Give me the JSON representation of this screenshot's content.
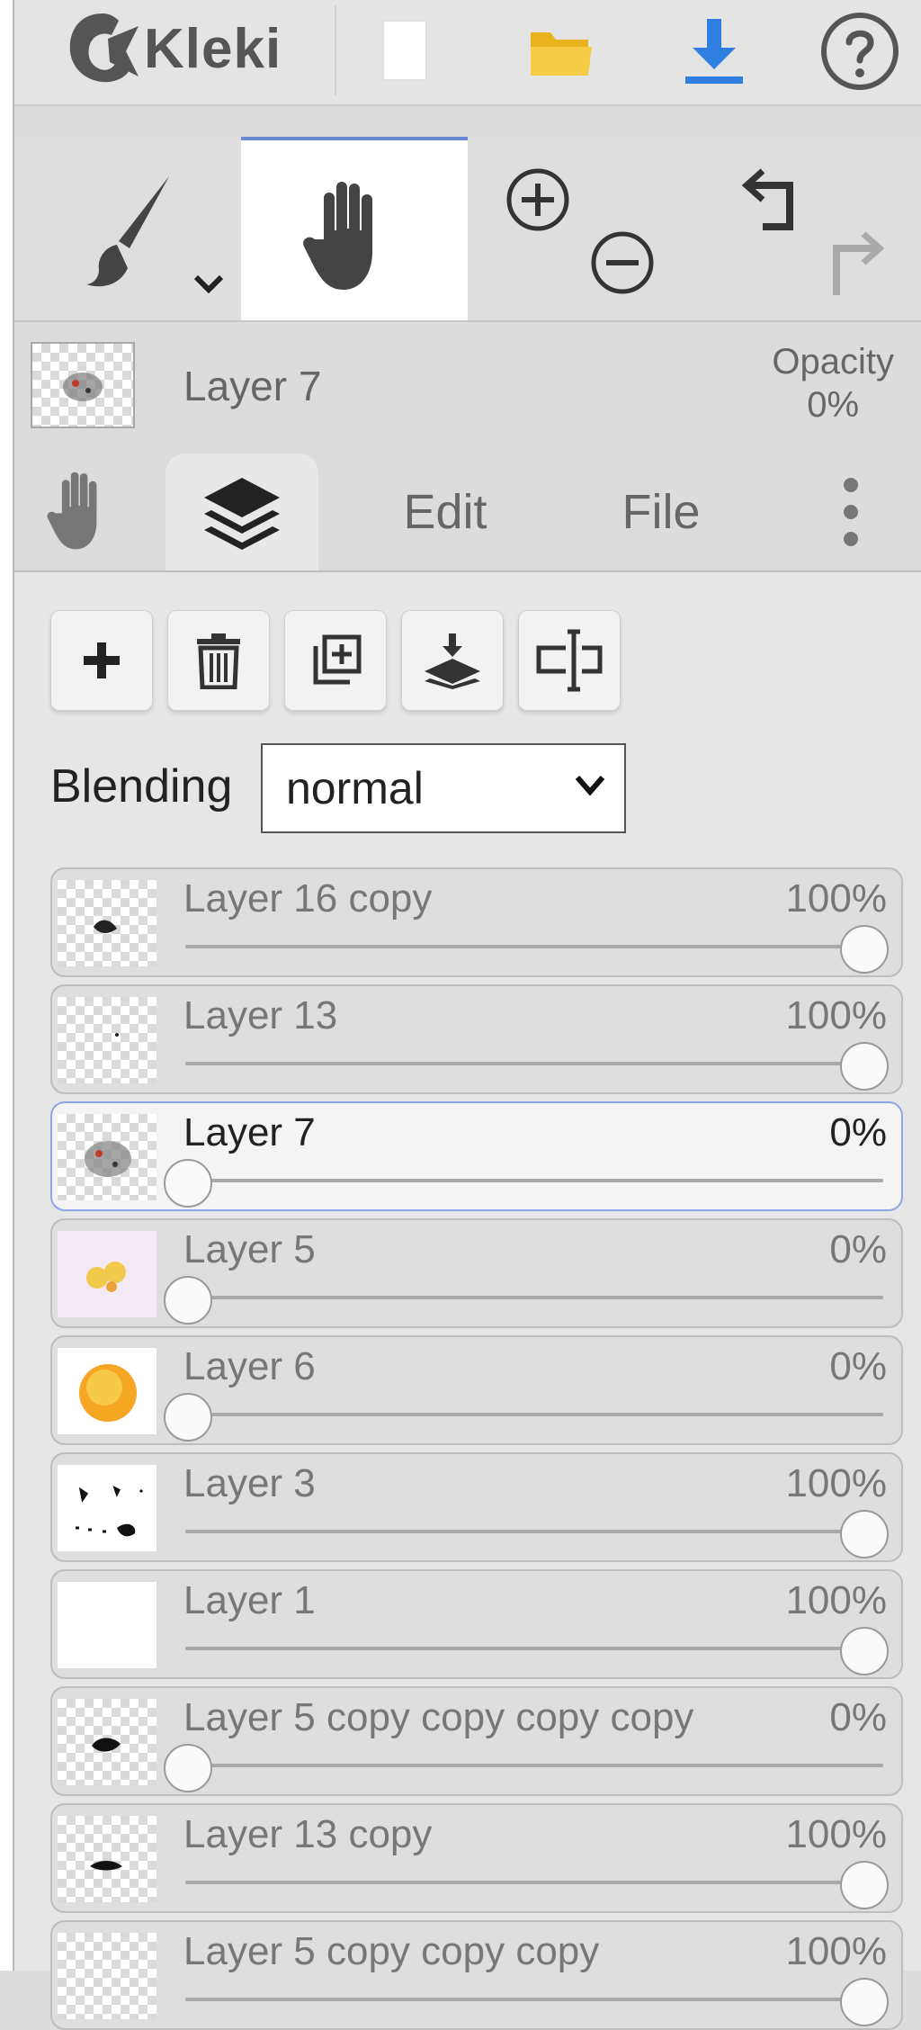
{
  "app": {
    "name": "Kleki"
  },
  "topbar": {
    "buttons": [
      "new-image",
      "open-file",
      "download",
      "help"
    ]
  },
  "toolbar": {
    "tools": [
      "brush",
      "hand",
      "zoom-in",
      "zoom-out",
      "undo",
      "redo"
    ],
    "active_tool": "hand"
  },
  "current_layer": {
    "name": "Layer 7",
    "opacity_label": "Opacity",
    "opacity_value": "0%"
  },
  "tabs": {
    "edit": "Edit",
    "file": "File",
    "active": "layers"
  },
  "layer_actions": [
    "add-layer",
    "delete-layer",
    "duplicate-layer",
    "merge-down",
    "rename-layer"
  ],
  "blending": {
    "label": "Blending",
    "value": "normal"
  },
  "layers": [
    {
      "name": "Layer 16 copy",
      "opacity": "100%",
      "opacity_fraction": 1.0,
      "selected": false
    },
    {
      "name": "Layer 13",
      "opacity": "100%",
      "opacity_fraction": 1.0,
      "selected": false
    },
    {
      "name": "Layer 7",
      "opacity": "0%",
      "opacity_fraction": 0.0,
      "selected": true
    },
    {
      "name": "Layer 5",
      "opacity": "0%",
      "opacity_fraction": 0.0,
      "selected": false
    },
    {
      "name": "Layer 6",
      "opacity": "0%",
      "opacity_fraction": 0.0,
      "selected": false
    },
    {
      "name": "Layer 3",
      "opacity": "100%",
      "opacity_fraction": 1.0,
      "selected": false
    },
    {
      "name": "Layer 1",
      "opacity": "100%",
      "opacity_fraction": 1.0,
      "selected": false
    },
    {
      "name": "Layer 5 copy copy copy copy",
      "opacity": "0%",
      "opacity_fraction": 0.0,
      "selected": false
    },
    {
      "name": "Layer 13 copy",
      "opacity": "100%",
      "opacity_fraction": 1.0,
      "selected": false
    },
    {
      "name": "Layer 5 copy copy copy",
      "opacity": "100%",
      "opacity_fraction": 1.0,
      "selected": false
    }
  ],
  "colors": {
    "accent": "#2f7fe0",
    "folder": "#f4c430",
    "selection_border": "#8ea6e6"
  }
}
